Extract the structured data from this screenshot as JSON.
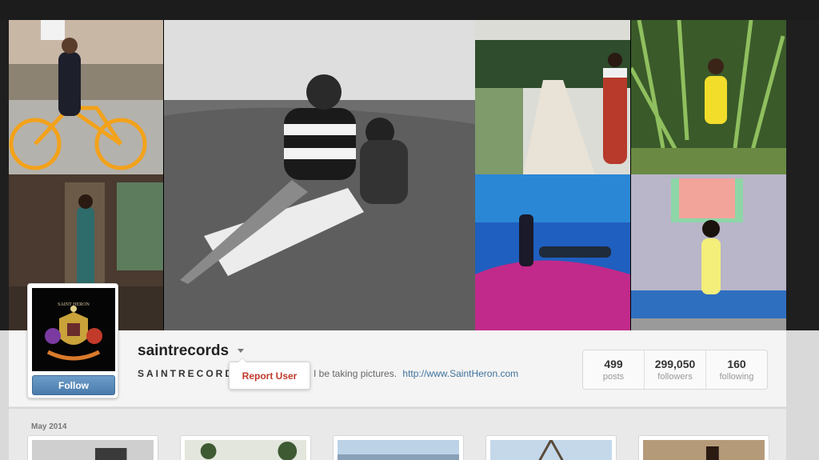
{
  "profile": {
    "username": "saintrecords",
    "full_name": "SAINTRECORDS",
    "bio_text": "I be taking pictures.",
    "bio_link": "http://www.SaintHeron.com",
    "follow_label": "Follow",
    "avatar_text": "SAINT HERON"
  },
  "menu": {
    "report_label": "Report User"
  },
  "stats": [
    {
      "value": "499",
      "label": "posts"
    },
    {
      "value": "299,050",
      "label": "followers"
    },
    {
      "value": "160",
      "label": "following"
    }
  ],
  "feed": {
    "month_label": "May 2014"
  },
  "colors": {
    "follow_button": "#4a7bab",
    "link": "#3f729b",
    "report": "#c0392b"
  },
  "icons": {
    "menu_caret": "chevron-down-icon"
  }
}
